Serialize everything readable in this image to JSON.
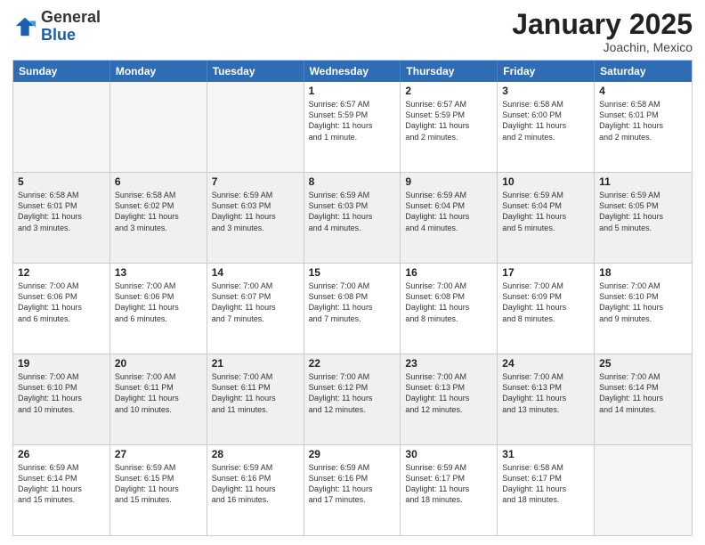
{
  "logo": {
    "line1": "General",
    "line2": "Blue"
  },
  "header": {
    "month": "January 2025",
    "location": "Joachin, Mexico"
  },
  "days_of_week": [
    "Sunday",
    "Monday",
    "Tuesday",
    "Wednesday",
    "Thursday",
    "Friday",
    "Saturday"
  ],
  "weeks": [
    [
      {
        "day": "",
        "info": ""
      },
      {
        "day": "",
        "info": ""
      },
      {
        "day": "",
        "info": ""
      },
      {
        "day": "1",
        "info": "Sunrise: 6:57 AM\nSunset: 5:59 PM\nDaylight: 11 hours\nand 1 minute."
      },
      {
        "day": "2",
        "info": "Sunrise: 6:57 AM\nSunset: 5:59 PM\nDaylight: 11 hours\nand 2 minutes."
      },
      {
        "day": "3",
        "info": "Sunrise: 6:58 AM\nSunset: 6:00 PM\nDaylight: 11 hours\nand 2 minutes."
      },
      {
        "day": "4",
        "info": "Sunrise: 6:58 AM\nSunset: 6:01 PM\nDaylight: 11 hours\nand 2 minutes."
      }
    ],
    [
      {
        "day": "5",
        "info": "Sunrise: 6:58 AM\nSunset: 6:01 PM\nDaylight: 11 hours\nand 3 minutes."
      },
      {
        "day": "6",
        "info": "Sunrise: 6:58 AM\nSunset: 6:02 PM\nDaylight: 11 hours\nand 3 minutes."
      },
      {
        "day": "7",
        "info": "Sunrise: 6:59 AM\nSunset: 6:03 PM\nDaylight: 11 hours\nand 3 minutes."
      },
      {
        "day": "8",
        "info": "Sunrise: 6:59 AM\nSunset: 6:03 PM\nDaylight: 11 hours\nand 4 minutes."
      },
      {
        "day": "9",
        "info": "Sunrise: 6:59 AM\nSunset: 6:04 PM\nDaylight: 11 hours\nand 4 minutes."
      },
      {
        "day": "10",
        "info": "Sunrise: 6:59 AM\nSunset: 6:04 PM\nDaylight: 11 hours\nand 5 minutes."
      },
      {
        "day": "11",
        "info": "Sunrise: 6:59 AM\nSunset: 6:05 PM\nDaylight: 11 hours\nand 5 minutes."
      }
    ],
    [
      {
        "day": "12",
        "info": "Sunrise: 7:00 AM\nSunset: 6:06 PM\nDaylight: 11 hours\nand 6 minutes."
      },
      {
        "day": "13",
        "info": "Sunrise: 7:00 AM\nSunset: 6:06 PM\nDaylight: 11 hours\nand 6 minutes."
      },
      {
        "day": "14",
        "info": "Sunrise: 7:00 AM\nSunset: 6:07 PM\nDaylight: 11 hours\nand 7 minutes."
      },
      {
        "day": "15",
        "info": "Sunrise: 7:00 AM\nSunset: 6:08 PM\nDaylight: 11 hours\nand 7 minutes."
      },
      {
        "day": "16",
        "info": "Sunrise: 7:00 AM\nSunset: 6:08 PM\nDaylight: 11 hours\nand 8 minutes."
      },
      {
        "day": "17",
        "info": "Sunrise: 7:00 AM\nSunset: 6:09 PM\nDaylight: 11 hours\nand 8 minutes."
      },
      {
        "day": "18",
        "info": "Sunrise: 7:00 AM\nSunset: 6:10 PM\nDaylight: 11 hours\nand 9 minutes."
      }
    ],
    [
      {
        "day": "19",
        "info": "Sunrise: 7:00 AM\nSunset: 6:10 PM\nDaylight: 11 hours\nand 10 minutes."
      },
      {
        "day": "20",
        "info": "Sunrise: 7:00 AM\nSunset: 6:11 PM\nDaylight: 11 hours\nand 10 minutes."
      },
      {
        "day": "21",
        "info": "Sunrise: 7:00 AM\nSunset: 6:11 PM\nDaylight: 11 hours\nand 11 minutes."
      },
      {
        "day": "22",
        "info": "Sunrise: 7:00 AM\nSunset: 6:12 PM\nDaylight: 11 hours\nand 12 minutes."
      },
      {
        "day": "23",
        "info": "Sunrise: 7:00 AM\nSunset: 6:13 PM\nDaylight: 11 hours\nand 12 minutes."
      },
      {
        "day": "24",
        "info": "Sunrise: 7:00 AM\nSunset: 6:13 PM\nDaylight: 11 hours\nand 13 minutes."
      },
      {
        "day": "25",
        "info": "Sunrise: 7:00 AM\nSunset: 6:14 PM\nDaylight: 11 hours\nand 14 minutes."
      }
    ],
    [
      {
        "day": "26",
        "info": "Sunrise: 6:59 AM\nSunset: 6:14 PM\nDaylight: 11 hours\nand 15 minutes."
      },
      {
        "day": "27",
        "info": "Sunrise: 6:59 AM\nSunset: 6:15 PM\nDaylight: 11 hours\nand 15 minutes."
      },
      {
        "day": "28",
        "info": "Sunrise: 6:59 AM\nSunset: 6:16 PM\nDaylight: 11 hours\nand 16 minutes."
      },
      {
        "day": "29",
        "info": "Sunrise: 6:59 AM\nSunset: 6:16 PM\nDaylight: 11 hours\nand 17 minutes."
      },
      {
        "day": "30",
        "info": "Sunrise: 6:59 AM\nSunset: 6:17 PM\nDaylight: 11 hours\nand 18 minutes."
      },
      {
        "day": "31",
        "info": "Sunrise: 6:58 AM\nSunset: 6:17 PM\nDaylight: 11 hours\nand 18 minutes."
      },
      {
        "day": "",
        "info": ""
      }
    ]
  ]
}
